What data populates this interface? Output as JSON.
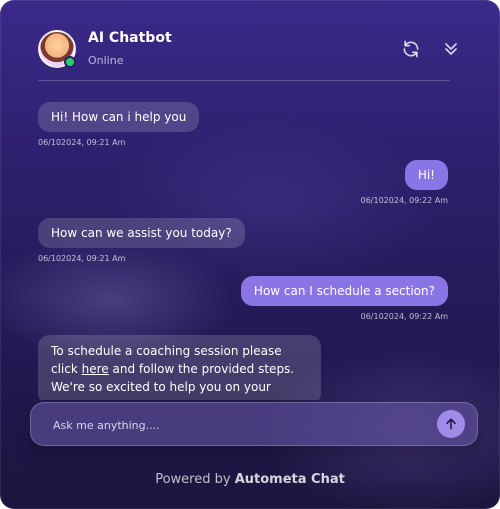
{
  "header": {
    "title": "AI Chatbot",
    "status": "Online",
    "icons": {
      "avatar": "chatbot-avatar",
      "refresh": "refresh-icon",
      "collapse": "chevron-down-double-icon"
    }
  },
  "messages": [
    {
      "role": "bot",
      "text": "Hi! How can i help you",
      "time": "06/102024, 09:21 Am"
    },
    {
      "role": "user",
      "text": "Hi!",
      "time": "06/102024, 09:22 Am"
    },
    {
      "role": "bot",
      "text": "How can we assist you today?",
      "time": "06/102024, 09:21 Am"
    },
    {
      "role": "user",
      "text": "How can I schedule a section?",
      "time": "06/102024, 09:22 Am"
    },
    {
      "role": "bot",
      "text_before": "To schedule a coaching session please click ",
      "link_text": "here",
      "text_after": " and follow the provided steps. We're so excited to help you on your"
    }
  ],
  "composer": {
    "placeholder": "Ask me anything....",
    "send_icon": "arrow-up-icon"
  },
  "footer": {
    "powered_prefix": "Powered by",
    "brand": "Autometa Chat"
  },
  "colors": {
    "panel_top": "#3b2a8a",
    "panel_bottom": "#1b163e",
    "user_bubble": "#8a75e7",
    "send_button": "#a08ce8",
    "online": "#25d366"
  }
}
